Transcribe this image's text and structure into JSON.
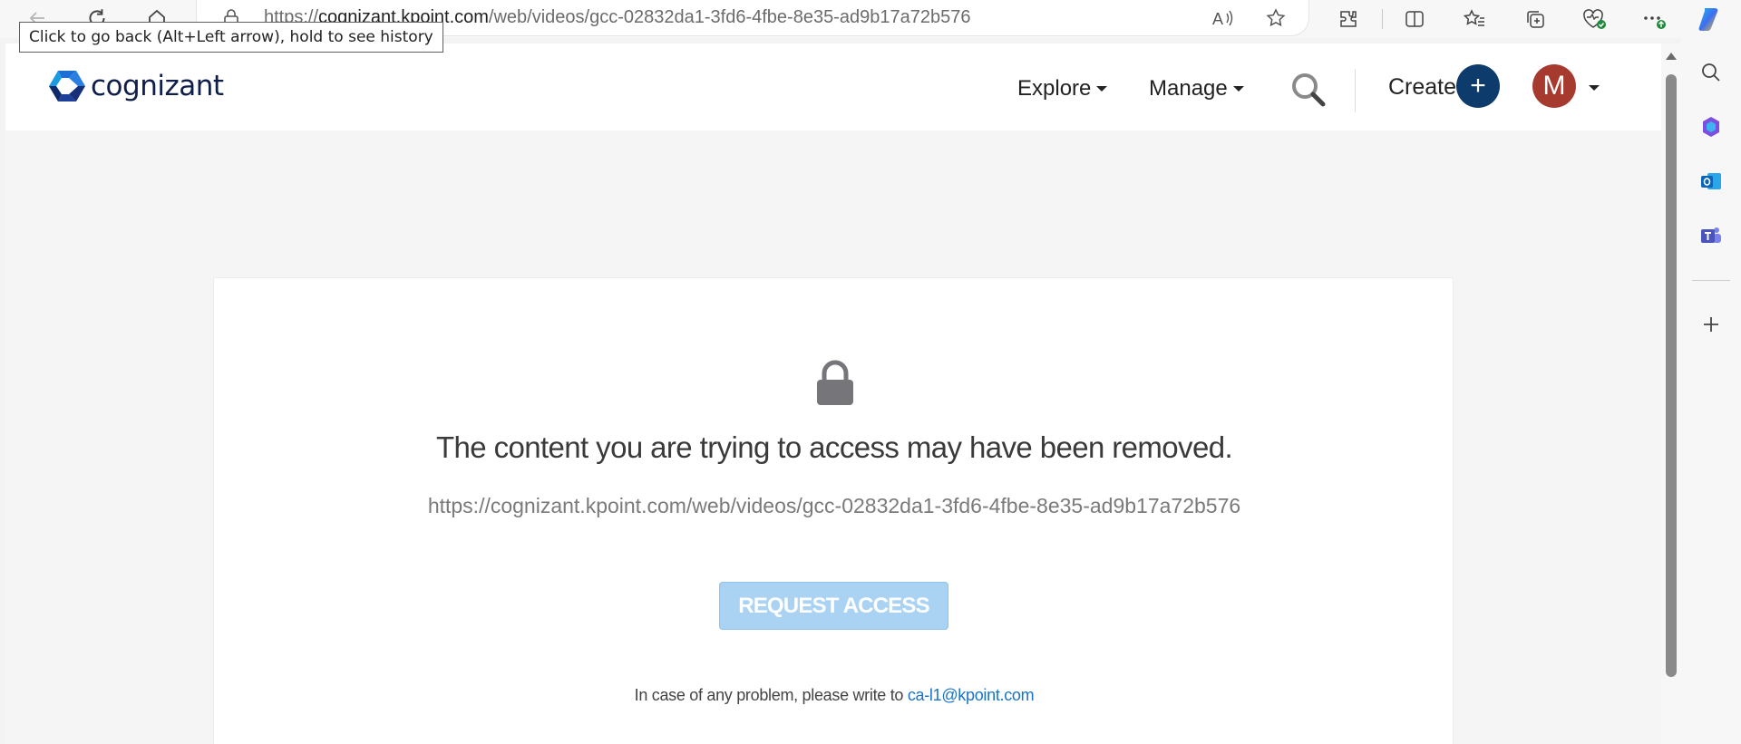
{
  "browser": {
    "url_host_prefix": "https://",
    "url_host": "cognizant.kpoint.com",
    "url_path": "/web/videos/gcc-02832da1-3fd6-4fbe-8e35-ad9b17a72b576",
    "tooltip": "Click to go back (Alt+Left arrow), hold to see history",
    "icons": [
      "back-icon",
      "refresh-icon",
      "home-icon",
      "lock-icon",
      "read-aloud-icon",
      "favorite-star-icon",
      "extensions-icon",
      "split-screen-icon",
      "favorites-icon",
      "collections-icon",
      "browser-essentials-icon",
      "more-icon",
      "copilot-icon"
    ],
    "sidebar_icons": [
      "search-icon",
      "copilot-apps-icon",
      "outlook-icon",
      "teams-icon",
      "add-icon"
    ]
  },
  "header": {
    "logo_text": "cognizant",
    "nav": {
      "explore": "Explore",
      "manage": "Manage"
    },
    "create_label": "Create",
    "create_button": "+",
    "avatar_initial": "M"
  },
  "content": {
    "message": "The content you are trying to access may have been removed.",
    "url": "https://cognizant.kpoint.com/web/videos/gcc-02832da1-3fd6-4fbe-8e35-ad9b17a72b576",
    "request_button": "REQUEST ACCESS",
    "problem_text": "In case of any problem, please write to",
    "contact_email": "ca-l1@kpoint.com"
  },
  "colors": {
    "brand_navy": "#0d3b6b",
    "avatar_red": "#a63a2f",
    "button_disabled_blue": "#a9d2f3",
    "link_blue": "#1a73c8"
  }
}
